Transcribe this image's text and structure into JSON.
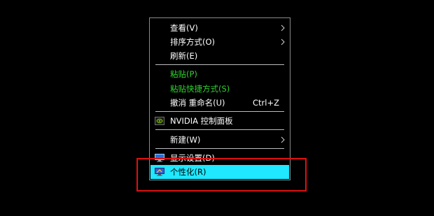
{
  "menu": {
    "view": {
      "label": "查看(V)"
    },
    "sort": {
      "label": "排序方式(O)"
    },
    "refresh": {
      "label": "刷新(E)"
    },
    "paste": {
      "label": "粘贴(P)"
    },
    "paste_shortcut": {
      "label": "粘贴快捷方式(S)"
    },
    "undo_rename": {
      "label": "撤消 重命名(U)",
      "shortcut": "Ctrl+Z"
    },
    "nvidia": {
      "label": "NVIDIA 控制面板"
    },
    "new": {
      "label": "新建(W)"
    },
    "display_settings": {
      "label": "显示设置(D)"
    },
    "personalize": {
      "label": "个性化(R)"
    }
  },
  "colors": {
    "background": "#000000",
    "menu_border": "#8a8a8a",
    "highlight": "#1fe8ff",
    "green_text": "#2fd22f",
    "annotation": "#e01010"
  }
}
